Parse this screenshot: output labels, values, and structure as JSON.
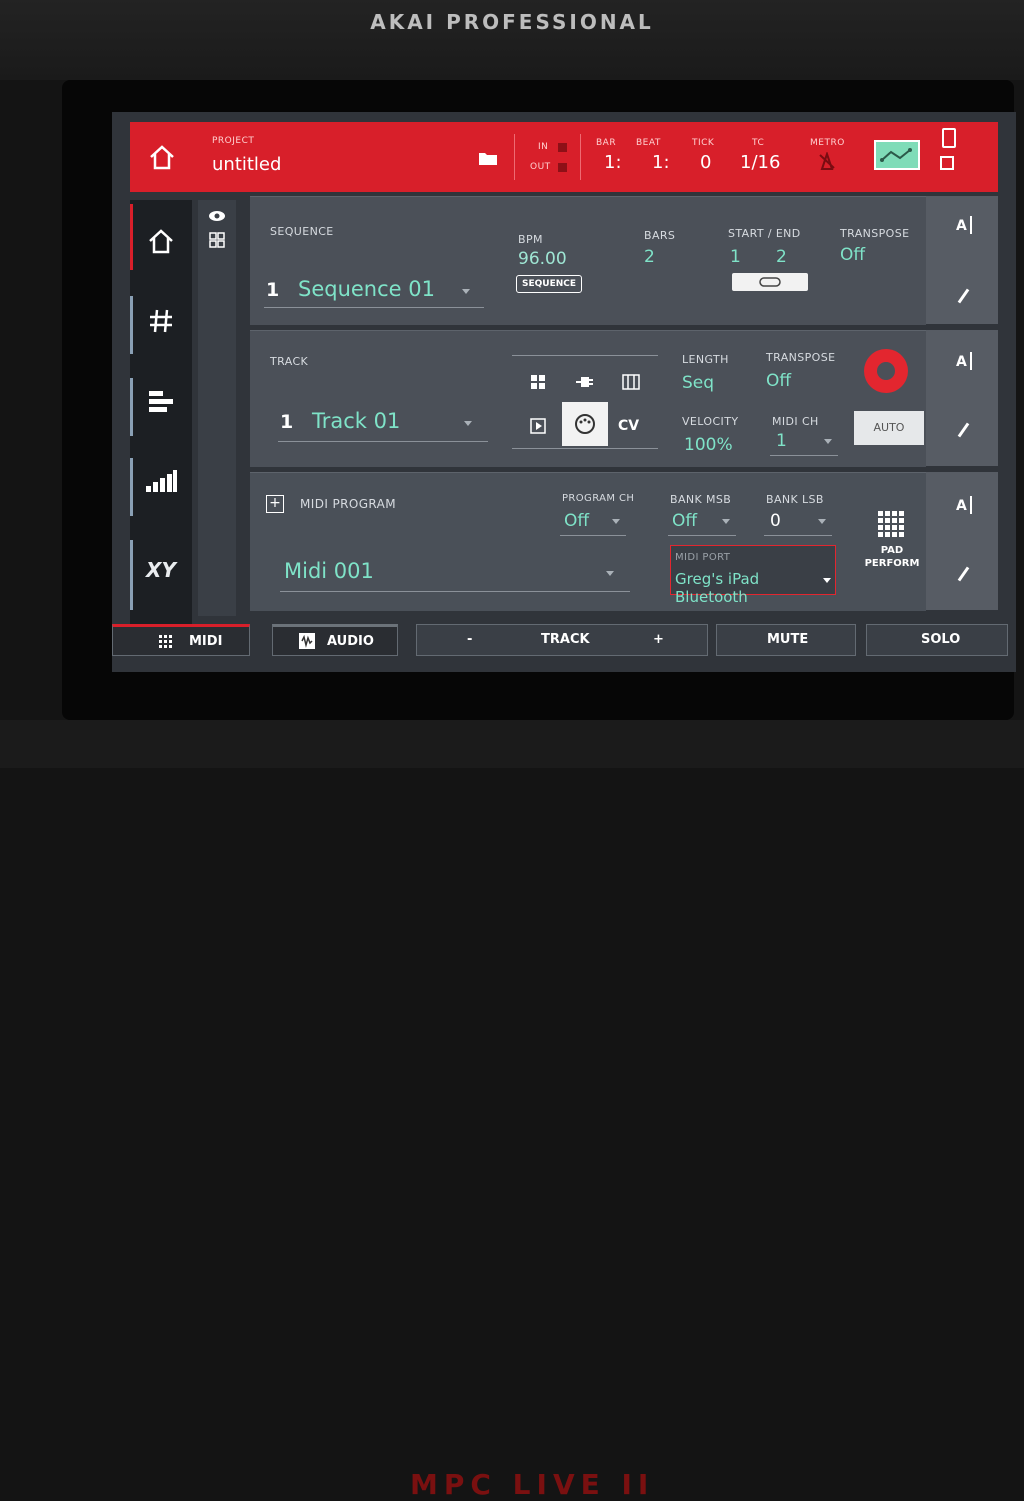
{
  "device": {
    "brand": "AKAI PROFESSIONAL"
  },
  "header": {
    "project_label": "PROJECT",
    "project_name": "untitled",
    "in_label": "IN",
    "out_label": "OUT",
    "bar_label": "BAR",
    "bar_value": "1:",
    "beat_label": "BEAT",
    "beat_value": "1:",
    "tick_label": "TICK",
    "tick_value": "0",
    "tc_label": "TC",
    "tc_value": "1/16",
    "metro_label": "METRO"
  },
  "sidebar": {
    "items": [
      "home-icon",
      "grid-hash-icon",
      "align-icon",
      "level-bars-icon",
      "xy-icon"
    ]
  },
  "sequence": {
    "label": "SEQUENCE",
    "number": "1",
    "name": "Sequence 01",
    "bpm_label": "BPM",
    "bpm_value": "96.00",
    "sequence_button": "SEQUENCE",
    "bars_label": "BARS",
    "bars_value": "2",
    "start_end_label": "START / END",
    "start_value": "1",
    "end_value": "2",
    "transpose_label": "TRANSPOSE",
    "transpose_value": "Off"
  },
  "track": {
    "label": "TRACK",
    "number": "1",
    "name": "Track 01",
    "cv_label": "CV",
    "length_label": "LENGTH",
    "length_value": "Seq",
    "transpose_label": "TRANSPOSE",
    "transpose_value": "Off",
    "velocity_label": "VELOCITY",
    "velocity_value": "100%",
    "midi_ch_label": "MIDI CH",
    "midi_ch_value": "1",
    "auto_button": "AUTO"
  },
  "midi_program": {
    "label": "MIDI PROGRAM",
    "name": "Midi 001",
    "program_ch_label": "PROGRAM CH",
    "program_ch_value": "Off",
    "bank_msb_label": "BANK MSB",
    "bank_msb_value": "Off",
    "bank_lsb_label": "BANK LSB",
    "bank_lsb_value": "0",
    "midi_port_label": "MIDI PORT",
    "midi_port_value": "Greg's iPad Bluetooth",
    "pad_perform_line1": "PAD",
    "pad_perform_line2": "PERFORM"
  },
  "edit_label": "A",
  "bottom_bar": {
    "midi": "MIDI",
    "audio": "AUDIO",
    "track_minus": "-",
    "track": "TRACK",
    "track_plus": "+",
    "mute": "MUTE",
    "solo": "SOLO"
  },
  "colors": {
    "accent_red": "#d81f2a",
    "value_teal": "#7fe3c8",
    "panel": "#4b5058"
  }
}
